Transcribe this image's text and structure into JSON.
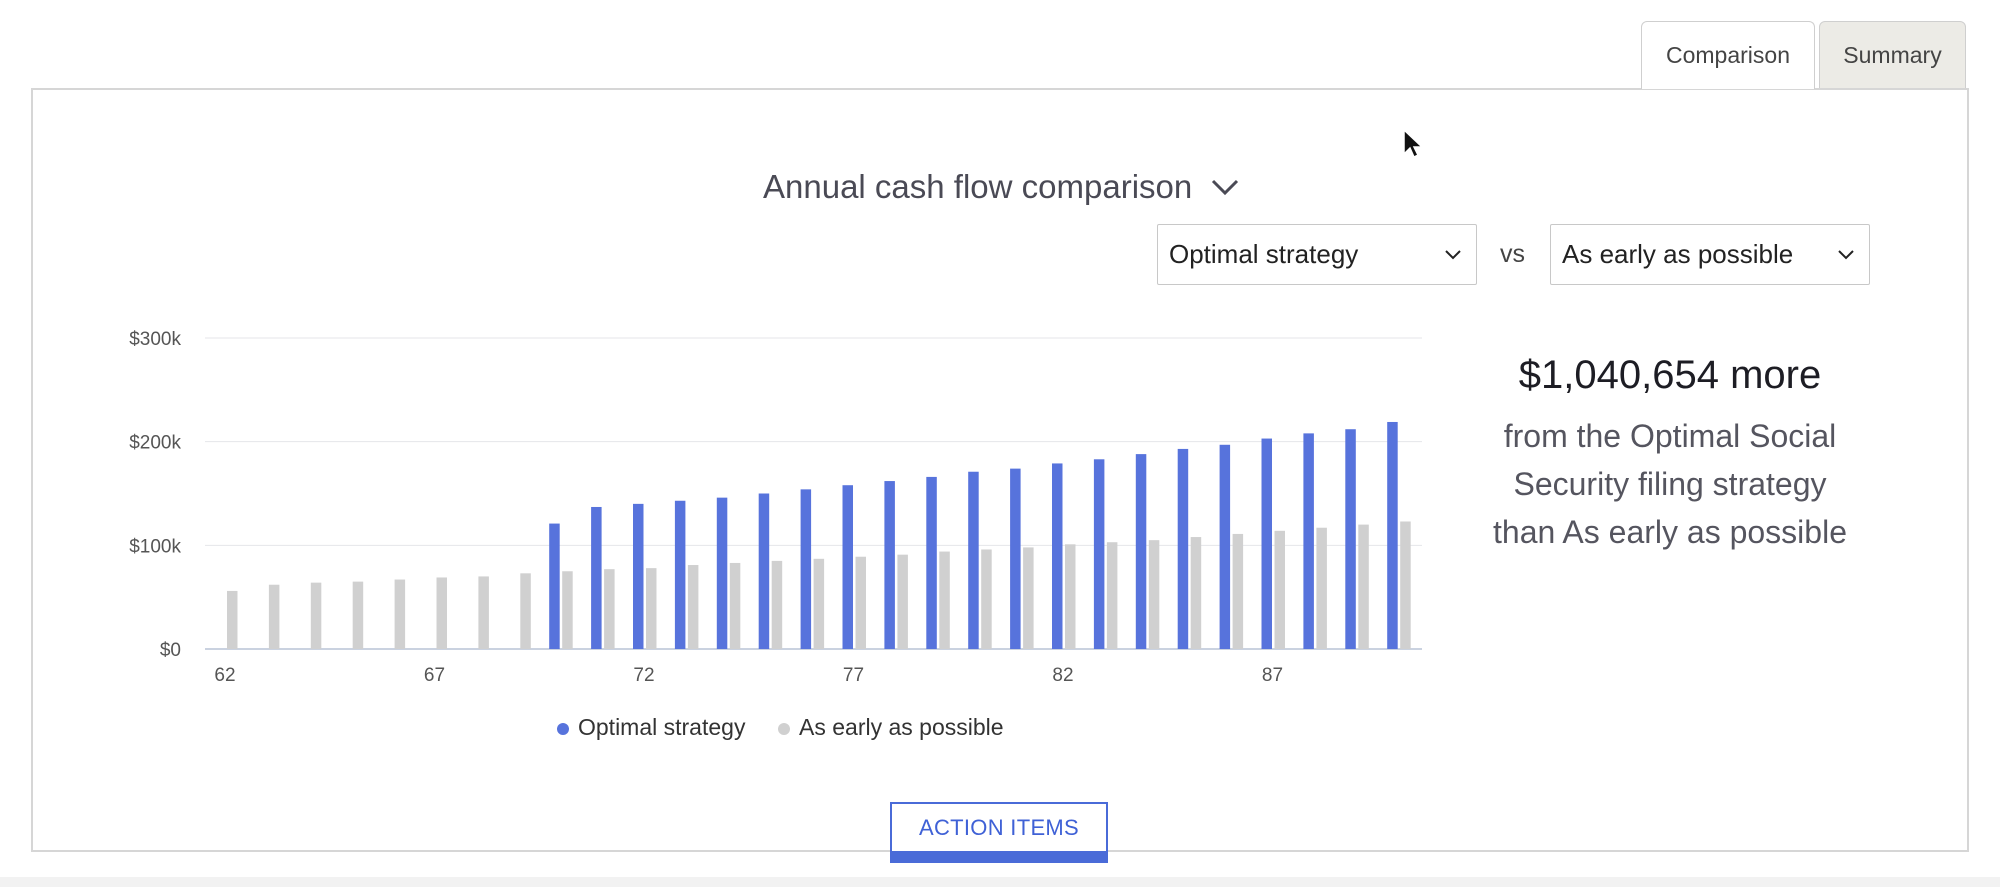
{
  "tabs": [
    {
      "label": "Comparison",
      "active": true
    },
    {
      "label": "Summary",
      "active": false
    }
  ],
  "chart_selector": {
    "label": "Annual cash flow comparison"
  },
  "compare": {
    "left_select": "Optimal strategy",
    "vs_label": "vs",
    "right_select": "As early as possible"
  },
  "summary": {
    "amount_line": "$1,040,654 more",
    "text_lines": [
      "from the Optimal Social",
      "Security filing strategy",
      "than As early as possible"
    ]
  },
  "action_button": {
    "label": "ACTION ITEMS"
  },
  "colors": {
    "optimal": "#5773dc",
    "early": "#d0d0d0",
    "accent": "#3f61d6"
  },
  "chart_data": {
    "type": "bar",
    "x_label": "",
    "y_label": "",
    "ylim": [
      0,
      300000
    ],
    "y_ticks": [
      0,
      100000,
      200000,
      300000
    ],
    "y_tick_labels": [
      "$0",
      "$100k",
      "$200k",
      "$300k"
    ],
    "x_tick_labels": [
      "62",
      "67",
      "72",
      "77",
      "82",
      "87"
    ],
    "x": [
      62,
      63,
      64,
      65,
      66,
      67,
      68,
      69,
      70,
      71,
      72,
      73,
      74,
      75,
      76,
      77,
      78,
      79,
      80,
      81,
      82,
      83,
      84,
      85,
      86,
      87,
      88,
      89,
      90
    ],
    "grid": true,
    "legend_position": "bottom",
    "series": [
      {
        "name": "Optimal strategy",
        "values": [
          0,
          0,
          0,
          0,
          0,
          0,
          0,
          0,
          121000,
          137000,
          140000,
          143000,
          146000,
          150000,
          154000,
          158000,
          162000,
          166000,
          171000,
          174000,
          179000,
          183000,
          188000,
          193000,
          197000,
          203000,
          208000,
          212000,
          219000
        ]
      },
      {
        "name": "As early as possible",
        "values": [
          56000,
          62000,
          64000,
          65000,
          67000,
          69000,
          70000,
          73000,
          75000,
          77000,
          78000,
          81000,
          83000,
          85000,
          87000,
          89000,
          91000,
          94000,
          96000,
          98000,
          101000,
          103000,
          105000,
          108000,
          111000,
          114000,
          117000,
          120000,
          123000
        ]
      }
    ]
  }
}
